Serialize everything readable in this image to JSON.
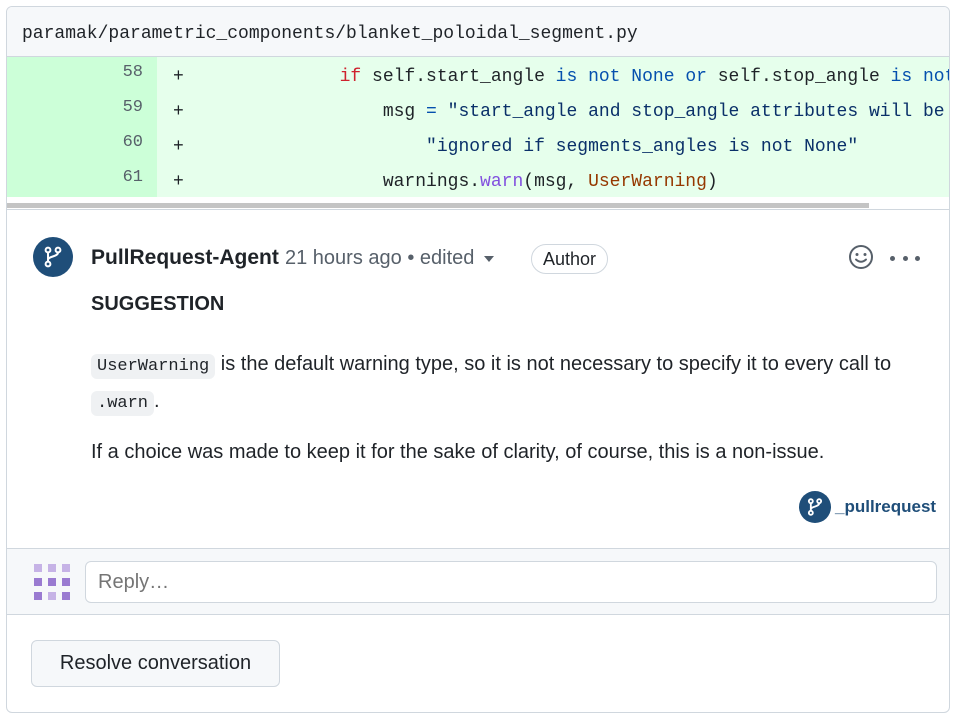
{
  "file": {
    "path": "paramak/parametric_components/blanket_poloidal_segment.py"
  },
  "diff": {
    "lines": [
      {
        "number": "58",
        "sign": "+",
        "tokens": [
          {
            "text": "            ",
            "cls": ""
          },
          {
            "text": "if",
            "cls": "kw"
          },
          {
            "text": " self.start_angle ",
            "cls": ""
          },
          {
            "text": "is not",
            "cls": "op"
          },
          {
            "text": " ",
            "cls": ""
          },
          {
            "text": "None",
            "cls": "op"
          },
          {
            "text": " ",
            "cls": ""
          },
          {
            "text": "or",
            "cls": "op"
          },
          {
            "text": " self.stop_angle ",
            "cls": ""
          },
          {
            "text": "is not",
            "cls": "op"
          }
        ]
      },
      {
        "number": "59",
        "sign": "+",
        "tokens": [
          {
            "text": "                msg ",
            "cls": ""
          },
          {
            "text": "=",
            "cls": "op"
          },
          {
            "text": " ",
            "cls": ""
          },
          {
            "text": "\"start_angle and stop_angle attributes will be \"",
            "cls": "str"
          }
        ]
      },
      {
        "number": "60",
        "sign": "+",
        "tokens": [
          {
            "text": "                    ",
            "cls": ""
          },
          {
            "text": "\"ignored if segments_angles is not None\"",
            "cls": "str"
          }
        ]
      },
      {
        "number": "61",
        "sign": "+",
        "tokens": [
          {
            "text": "                warnings.",
            "cls": ""
          },
          {
            "text": "warn",
            "cls": "fn"
          },
          {
            "text": "(msg, ",
            "cls": ""
          },
          {
            "text": "UserWarning",
            "cls": "cls"
          },
          {
            "text": ")",
            "cls": ""
          }
        ]
      }
    ]
  },
  "comment": {
    "author": "PullRequest-Agent",
    "time": "21 hours ago",
    "separator": "•",
    "edited": "edited",
    "badge": "Author",
    "heading": "SUGGESTION",
    "para1_code1": "UserWarning",
    "para1_text1": " is the default warning type, so it is not necessary to specify it to every call to ",
    "para1_code2": ".warn",
    "para1_text2": ".",
    "para2": "If a choice was made to keep it for the sake of clarity, of course, this is a non-issue.",
    "signature": "_pullrequest"
  },
  "reply": {
    "placeholder": "Reply…"
  },
  "actions": {
    "resolve_label": "Resolve conversation"
  },
  "colors": {
    "brand": "#1f4e79",
    "diff_add_bg": "#e6ffec",
    "diff_add_gutter": "#ccffd8"
  },
  "icons": {
    "author_avatar": "git-branch-icon",
    "emoji": "smiley-icon",
    "more": "kebab-icon",
    "reply_avatar": "identicon"
  }
}
